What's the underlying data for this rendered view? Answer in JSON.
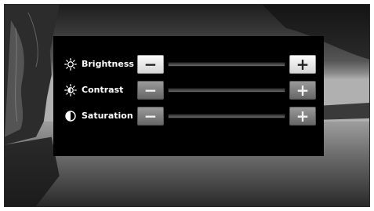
{
  "controls": [
    {
      "label": "Brightness",
      "icon": "sun-icon",
      "minus_label": "−",
      "plus_label": "+"
    },
    {
      "label": "Contrast",
      "icon": "contrast-sun-icon",
      "minus_label": "−",
      "plus_label": "+"
    },
    {
      "label": "Saturation",
      "icon": "half-circle-icon",
      "minus_label": "−",
      "plus_label": "+"
    }
  ],
  "colors": {
    "panel_background": "#000000",
    "label_text": "#ffffff"
  }
}
